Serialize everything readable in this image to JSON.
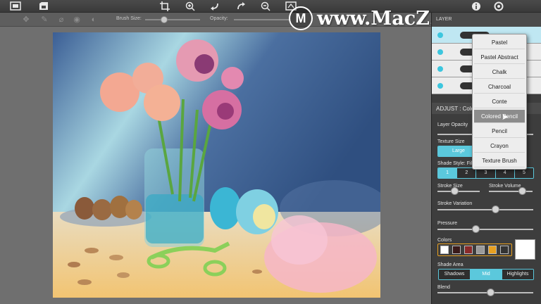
{
  "toolbar": {
    "icons": [
      "image-icon",
      "save-icon",
      "crop-icon",
      "zoom-in-icon",
      "undo-icon",
      "redo-icon",
      "zoom-out-icon",
      "compare-icon",
      "info-icon",
      "settings-icon"
    ]
  },
  "options_bar": {
    "brush_size_label": "Brush Size:",
    "opacity_label": "Opacity:",
    "brush_size_value": 0.35,
    "opacity_value": 0.8
  },
  "watermark": {
    "logo_letter": "M",
    "text": "www.MacZ.com"
  },
  "layers": {
    "header": "LAYER",
    "rows": 4
  },
  "adjust": {
    "header": "ADJUST : Colored Pencil",
    "layer_opacity_label": "Layer Opacity",
    "texture_size_label": "Texture Size",
    "texture_size_selected": "Large",
    "shade_style_label": "Shade Style: Fill",
    "shade_style_options": [
      "1",
      "2",
      "3",
      "4",
      "5"
    ],
    "shade_style_selected": "1",
    "stroke_size_label": "Stroke Size",
    "stroke_volume_label": "Stroke Volume",
    "stroke_variation_label": "Stroke Variation",
    "pressure_label": "Pressure",
    "colors_label": "Colors",
    "shade_area_label": "Shade Area",
    "shade_area_options": [
      "Shadows",
      "Mid",
      "Highlights"
    ],
    "shade_area_selected": "Mid",
    "blend_label": "Blend",
    "stroke_size_value": 0.4,
    "stroke_volume_value": 0.75,
    "stroke_variation_value": 0.6,
    "pressure_value": 0.4,
    "blend_value": 0.55,
    "swatch_colors": [
      "#ffffff",
      "#3a1a1a",
      "#8a2a2a",
      "#9a9a9a",
      "#e8a020",
      "#333333"
    ]
  },
  "dropdown": {
    "items": [
      "Pastel",
      "Pastel Abstract",
      "Chalk",
      "Charcoal",
      "Conte",
      "Colored Pencil",
      "Pencil",
      "Crayon",
      "Texture Brush"
    ],
    "highlighted": "Colored Pencil"
  },
  "colors": {
    "accent": "#5bc8dc"
  }
}
